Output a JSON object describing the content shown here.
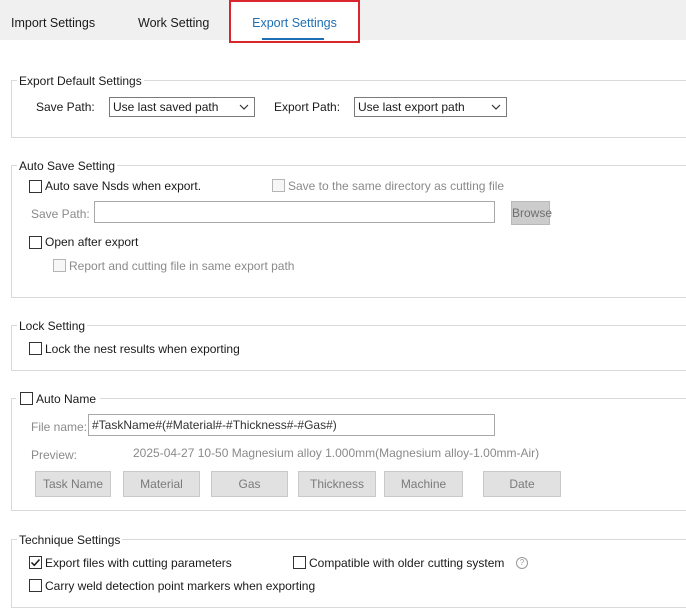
{
  "tabs": [
    {
      "label": "Import Settings",
      "active": false
    },
    {
      "label": "Work Setting",
      "active": false
    },
    {
      "label": "Export Settings",
      "active": true
    }
  ],
  "accent_color": "#1f6fb5",
  "highlight_color": "#d8262c",
  "export_default": {
    "title": "Export Default Settings",
    "save_path_label": "Save Path:",
    "save_path_value": "Use last saved path",
    "export_path_label": "Export Path:",
    "export_path_value": "Use last export path"
  },
  "auto_save": {
    "title": "Auto Save Setting",
    "auto_save_nsds_label": "Auto save Nsds when export.",
    "auto_save_nsds_checked": false,
    "same_directory_label": "Save to the same directory as cutting file",
    "same_directory_checked": false,
    "save_path_label": "Save Path:",
    "save_path_value": "",
    "browse_label": "Browse",
    "open_after_export_label": "Open after export",
    "open_after_export_checked": false,
    "report_same_path_label": "Report and cutting file in same export path",
    "report_same_path_checked": false
  },
  "lock": {
    "title": "Lock Setting",
    "lock_nest_label": "Lock the nest results when exporting",
    "lock_nest_checked": false
  },
  "auto_name": {
    "title": "Auto Name",
    "checked": false,
    "file_name_label": "File name:",
    "file_name_value": "#TaskName#(#Material#-#Thickness#-#Gas#)",
    "preview_label": "Preview:",
    "preview_value": "2025-04-27 10-50 Magnesium alloy 1.000mm(Magnesium alloy-1.00mm-Air)",
    "tag_buttons": [
      "Task Name",
      "Material",
      "Gas",
      "Thickness",
      "Machine",
      "Date"
    ]
  },
  "technique": {
    "title": "Technique Settings",
    "export_params_label": "Export files with cutting parameters",
    "export_params_checked": true,
    "older_system_label": "Compatible with older cutting system",
    "older_system_checked": false,
    "help_glyph": "?",
    "weld_markers_label": "Carry weld detection point markers when exporting",
    "weld_markers_checked": false
  }
}
